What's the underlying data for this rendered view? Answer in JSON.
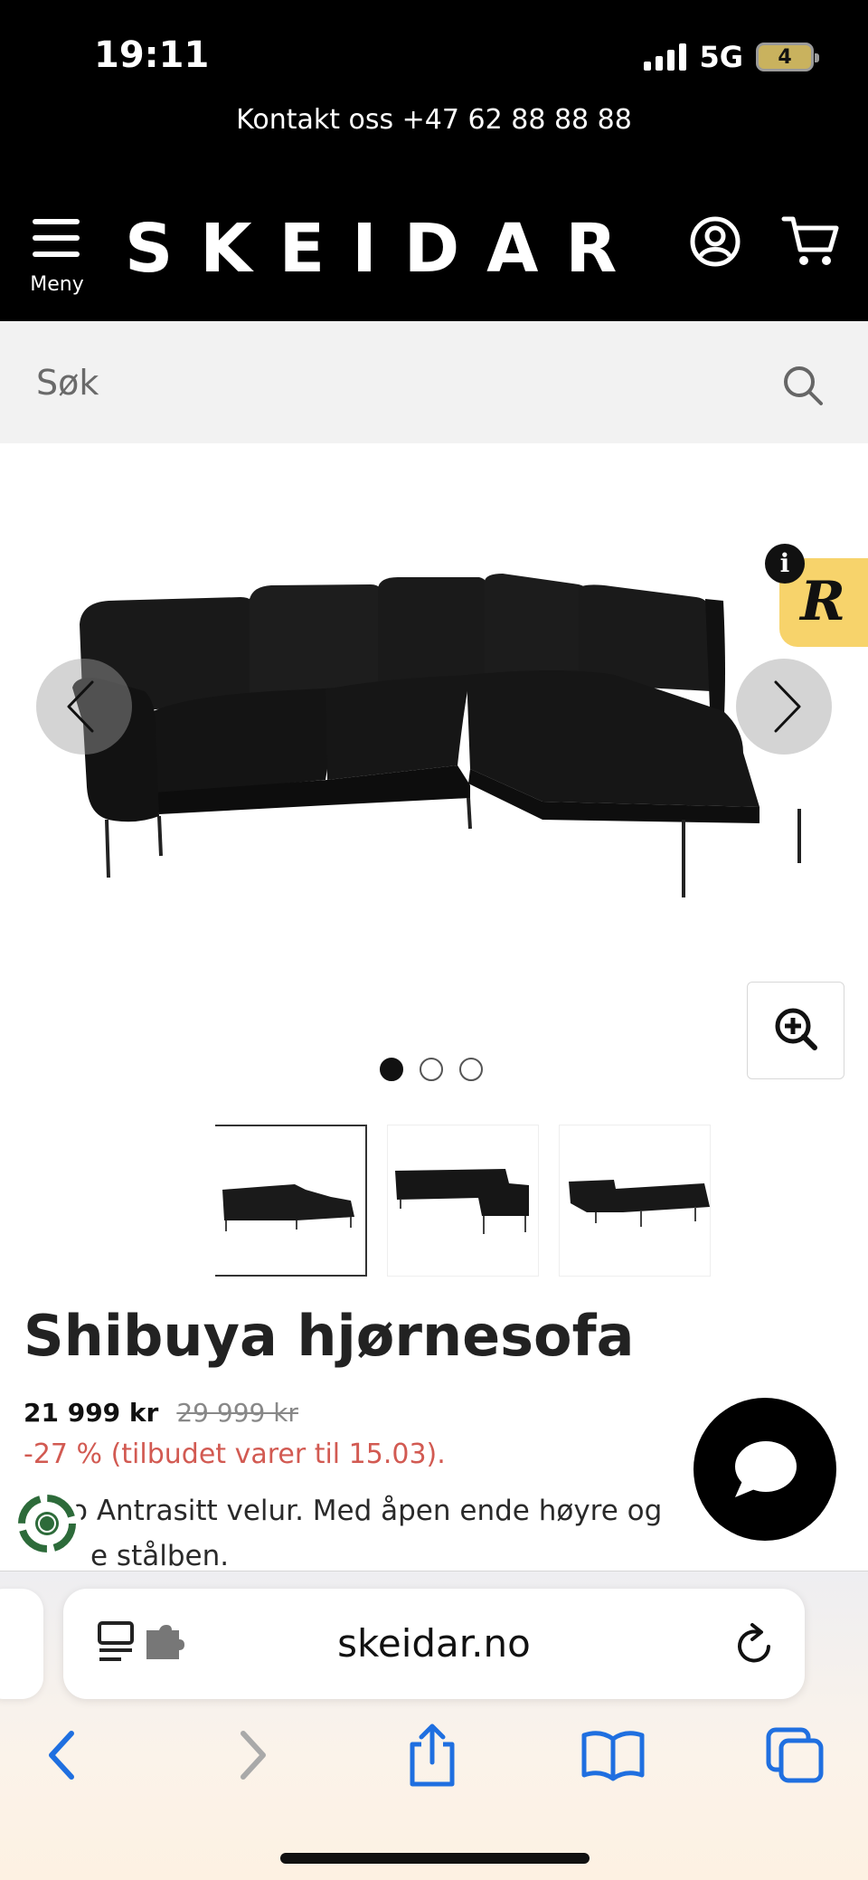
{
  "status_bar": {
    "time": "19:11",
    "network": "5G",
    "battery": "4"
  },
  "header": {
    "contact": "Kontakt oss +47 62 88 88 88",
    "menu_label": "Meny",
    "logo": "SKEIDAR"
  },
  "search": {
    "placeholder": "Søk"
  },
  "gallery": {
    "image_count": 3,
    "active_index": 0,
    "thumbnail_count": 3
  },
  "product": {
    "title": "Shibuya hjørnesofa",
    "price": "21 999 kr",
    "old_price": "29 999 kr",
    "discount": "-27 % (tilbudet varer til 15.03).",
    "description_line1": "o Antrasitt velur. Med åpen ende høyre og",
    "description_line2": "e stålben."
  },
  "browser": {
    "url": "skeidar.no"
  },
  "colors": {
    "header_bg": "#000000",
    "search_bg": "#f2f2f2",
    "discount_text": "#d25a52",
    "reviews_badge": "#f7d36b",
    "ios_blue": "#1f6fe0"
  }
}
